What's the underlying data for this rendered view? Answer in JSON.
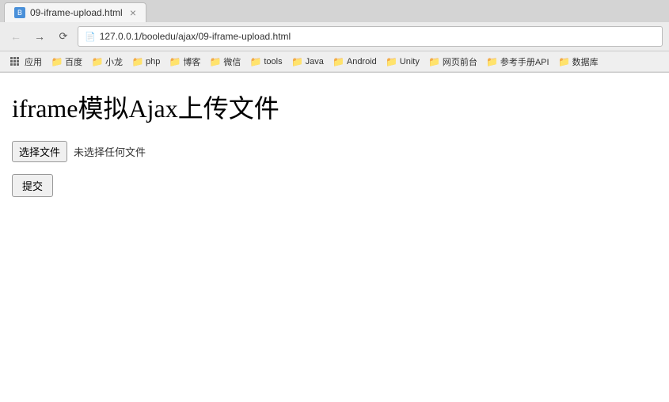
{
  "browser": {
    "tab": {
      "title": "09-iframe-upload.html",
      "favicon_label": "B"
    },
    "toolbar": {
      "url": "127.0.0.1/booledu/ajax/09-iframe-upload.html"
    },
    "bookmarks": [
      {
        "label": "应用",
        "type": "apps"
      },
      {
        "label": "百度",
        "type": "folder"
      },
      {
        "label": "小龙",
        "type": "folder"
      },
      {
        "label": "php",
        "type": "folder"
      },
      {
        "label": "博客",
        "type": "folder"
      },
      {
        "label": "微信",
        "type": "folder"
      },
      {
        "label": "tools",
        "type": "folder"
      },
      {
        "label": "Java",
        "type": "folder"
      },
      {
        "label": "Android",
        "type": "folder"
      },
      {
        "label": "Unity",
        "type": "folder"
      },
      {
        "label": "网页前台",
        "type": "folder"
      },
      {
        "label": "参考手册API",
        "type": "folder"
      },
      {
        "label": "数据库",
        "type": "folder"
      }
    ]
  },
  "page": {
    "title": "iframe模拟Ajax上传文件",
    "file_input_label": "选择文件",
    "no_file_text": "未选择任何文件",
    "submit_label": "提交"
  }
}
